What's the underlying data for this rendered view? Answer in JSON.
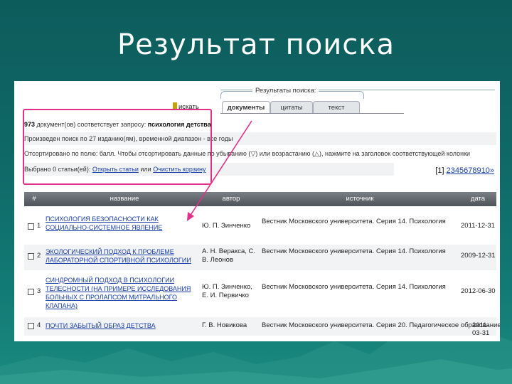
{
  "slide": {
    "title": "Результат поиска"
  },
  "panel": {
    "caption": "Результаты поиска:",
    "search_link": "искать",
    "tabs": [
      {
        "label": "документы",
        "active": true
      },
      {
        "label": "цитаты",
        "active": false
      },
      {
        "label": "текст",
        "active": false
      }
    ]
  },
  "summary": {
    "count": "973",
    "count_text": "документ(ов) соответствует запросу:",
    "query": "психология детства",
    "search_info": "Произведен поиск по 27 изданию(ям), временной диапазон - все годы",
    "sort_info": "Отсортировано по полю: балл. Чтобы отсортировать данные по убыванию (▽) или возрастанию (△), нажмите на заголовок соответствующей колонки",
    "selected_text": "Выбрано 0 статьи(ей):",
    "open_link": "Открыть статьи",
    "or_text": "или",
    "clear_link": "Очистить корзину"
  },
  "pagination": {
    "current": "[1]",
    "pages": [
      "2",
      "3",
      "4",
      "5",
      "6",
      "7",
      "8",
      "9",
      "10",
      "»"
    ]
  },
  "table": {
    "headers": [
      "#",
      "название",
      "автор",
      "источник",
      "дата"
    ],
    "rows": [
      {
        "num": "1",
        "title": "Психология безопасности как социально-системное явление",
        "author": "Ю. П. Зинченко",
        "source": "Вестник Московского университета. Серия 14. Психология",
        "date": "2011-12-31"
      },
      {
        "num": "2",
        "title": "Экологический подход к проблеме лабораторной спортивной психологии",
        "author": "А. Н. Веракса, С. В. Леонов",
        "source": "Вестник Московского университета. Серия 14. Психология",
        "date": "2009-12-31"
      },
      {
        "num": "3",
        "title": "Синдромный подход в психологии телесности (на примере исследования больных с пролапсом митрального клапана)",
        "author": "Ю. П. Зинченко, Е. И. Первичко",
        "source": "Вестник Московского университета. Серия 14. Психология",
        "date": "2012-06-30"
      },
      {
        "num": "4",
        "title": "Почти забытый образ детства",
        "author": "Г. В. Новикова",
        "source": "Вестник Московского университета. Серия 20. Педагогическое образование",
        "date": "2011-03-31"
      }
    ]
  }
}
